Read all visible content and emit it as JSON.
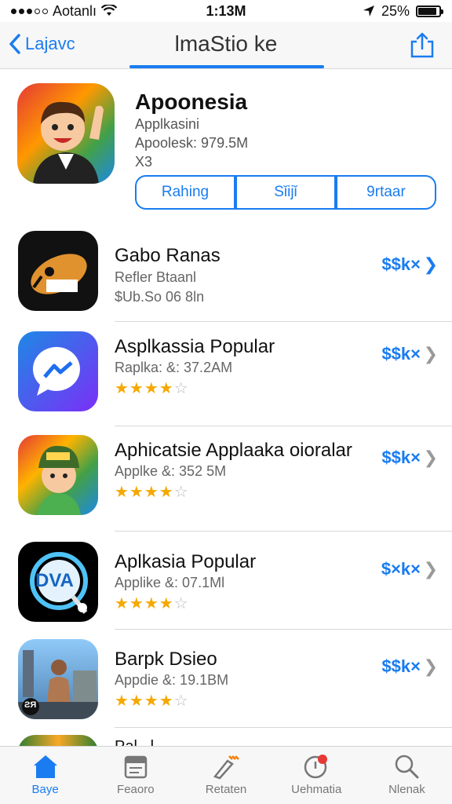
{
  "status": {
    "carrier": "Aotanlı",
    "time": "1:13M",
    "battery_text": "25%",
    "battery_level": 0.9
  },
  "nav": {
    "back_label": "Lajavc",
    "title": "lmaStio ke"
  },
  "featured": {
    "name": "Apoonesia",
    "category": "Applkasini",
    "size_line": "Apoolesk: 979.5M",
    "age": "X3",
    "segments": [
      "Rahing",
      "Sǐijǐ",
      "9rtaar"
    ],
    "active_segment": 1
  },
  "apps": [
    {
      "name": "Gabo Ranas",
      "meta": "Refler Btaanl",
      "extra": "$Ub.So 06 8ln",
      "price": "$$k×",
      "rating": null,
      "chevron": "blue"
    },
    {
      "name": "Asplkassia Popular",
      "meta": "Raplka: &: 37.2AM",
      "extra": null,
      "price": "$$k×",
      "rating": 4,
      "chevron": "gray"
    },
    {
      "name": "Aphicatsie Applaaka oioralar",
      "meta": "Applke &: 352 5M",
      "extra": null,
      "price": "$$k×",
      "rating": 4,
      "chevron": "gray"
    },
    {
      "name": "Aplkasia Popular",
      "meta": "Applike &: 07.1Ml",
      "extra": null,
      "price": "$×k×",
      "rating": 4,
      "chevron": "gray"
    },
    {
      "name": "Barpk Dsieo",
      "meta": "Appdie &: 19.1BM",
      "extra": null,
      "price": "$$k×",
      "rating": 4,
      "chevron": "gray"
    }
  ],
  "partial_row_text": "Pal...l...",
  "tabs": [
    {
      "label": "Baye",
      "icon": "home-icon"
    },
    {
      "label": "Feaoro",
      "icon": "featured-icon"
    },
    {
      "label": "Retaten",
      "icon": "categories-icon"
    },
    {
      "label": "Uehmatia",
      "icon": "updates-icon"
    },
    {
      "label": "Nlenak",
      "icon": "search-icon"
    }
  ],
  "active_tab": 0,
  "colors": {
    "accent": "#1a7cf0",
    "star": "#f5a800",
    "badge": "#e53935"
  }
}
